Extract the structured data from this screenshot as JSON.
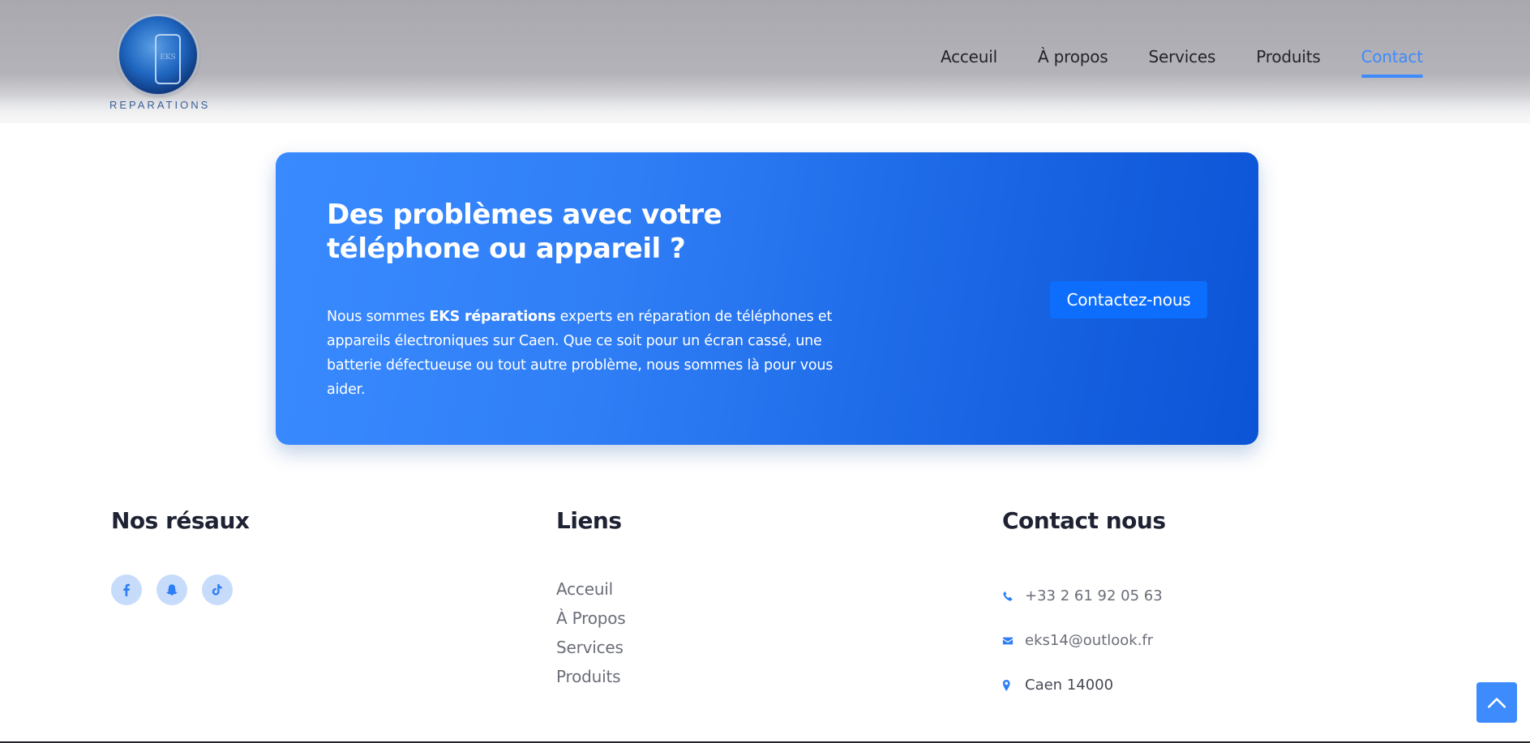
{
  "brand": {
    "logo_icon": "phone-in-circle-logo",
    "phone_text": "EKS",
    "name": "REPARATIONS"
  },
  "nav": {
    "items": [
      {
        "label": "Acceuil"
      },
      {
        "label": "À propos"
      },
      {
        "label": "Services"
      },
      {
        "label": "Produits"
      },
      {
        "label": "Contact"
      }
    ],
    "active_index": 4
  },
  "cta": {
    "title": "Des problèmes avec votre téléphone ou appareil ?",
    "desc_prefix": "Nous sommes ",
    "desc_bold": "EKS réparations",
    "desc_suffix": " experts en réparation de téléphones et appareils électroniques sur Caen. Que ce soit pour un écran cassé, une batterie défectueuse ou tout autre problème, nous sommes là pour vous aider.",
    "button_label": "Contactez-nous"
  },
  "footer": {
    "networks": {
      "title": "Nos résaux",
      "icons": [
        "facebook-icon",
        "snapchat-icon",
        "tiktok-icon"
      ]
    },
    "links": {
      "title": "Liens",
      "items": [
        "Acceuil",
        "À Propos",
        "Services",
        "Produits"
      ]
    },
    "contact": {
      "title": "Contact nous",
      "phone": "+33 2 61 92 05 63",
      "email": "eks14@outlook.fr",
      "location": "Caen 14000"
    }
  },
  "back_to_top_icon": "chevron-up-icon",
  "colors": {
    "accent": "#3d8bfd",
    "button": "#0d6efd",
    "card_start": "#3a8aff",
    "card_end": "#0b54d6"
  }
}
